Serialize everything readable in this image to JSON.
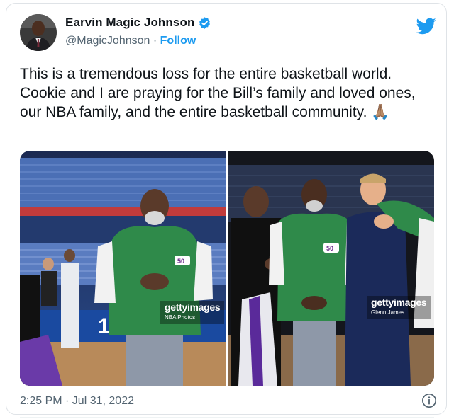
{
  "author": {
    "display_name": "Earvin Magic Johnson",
    "handle": "@MagicJohnson",
    "separator": "·",
    "follow_label": "Follow",
    "verified": true
  },
  "tweet": {
    "text": "This is a tremendous loss for the entire basketball world. Cookie and I are praying for the Bill’s family and loved ones, our NBA family, and the entire basketball community. 🙏🏽",
    "timestamp": "2:25 PM · Jul 31, 2022"
  },
  "media": [
    {
      "watermark_brand": "gettyimages",
      "watermark_credit": "NBA Photos"
    },
    {
      "watermark_brand": "gettyimages",
      "watermark_credit": "Glenn James"
    }
  ],
  "icons": {
    "platform": "twitter-bird-icon",
    "verified": "verified-badge-icon",
    "info": "info-icon"
  },
  "colors": {
    "accent": "#1d9bf0",
    "text": "#0f1419",
    "secondary": "#536471",
    "border": "#dfe3e7"
  }
}
